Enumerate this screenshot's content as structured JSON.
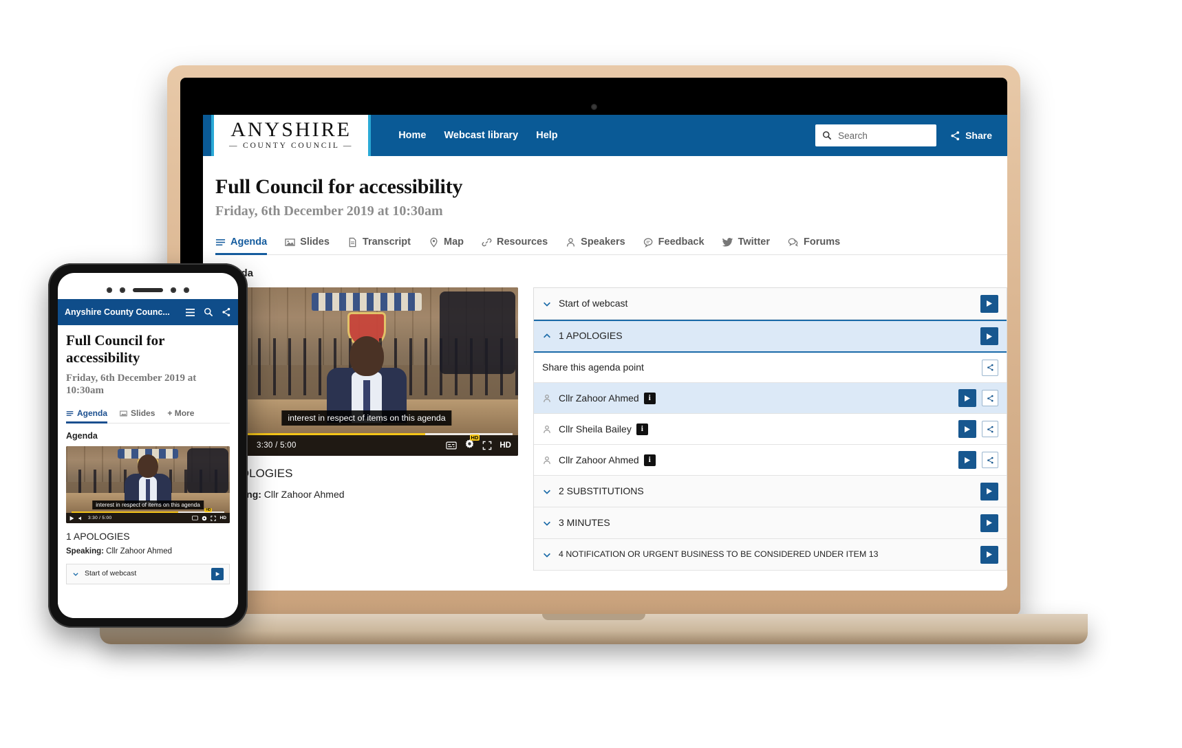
{
  "header": {
    "logo_main": "ANYSHIRE",
    "logo_sub": "— COUNTY COUNCIL —",
    "nav": [
      {
        "label": "Home"
      },
      {
        "label": "Webcast library"
      },
      {
        "label": "Help"
      }
    ],
    "search_placeholder": "Search",
    "search_value": "",
    "share_label": "Share",
    "bg_color": "#0a5a96",
    "accent_color": "#2aa9d6"
  },
  "page": {
    "title": "Full Council for accessibility",
    "subtitle": "Friday, 6th December 2019 at 10:30am",
    "section_label": "Agenda"
  },
  "tabs": [
    {
      "label": "Agenda",
      "icon": "list-icon",
      "active": true
    },
    {
      "label": "Slides",
      "icon": "image-icon",
      "active": false
    },
    {
      "label": "Transcript",
      "icon": "document-icon",
      "active": false
    },
    {
      "label": "Map",
      "icon": "pin-icon",
      "active": false
    },
    {
      "label": "Resources",
      "icon": "link-icon",
      "active": false
    },
    {
      "label": "Speakers",
      "icon": "person-icon",
      "active": false
    },
    {
      "label": "Feedback",
      "icon": "comment-icon",
      "active": false
    },
    {
      "label": "Twitter",
      "icon": "twitter-icon",
      "active": false
    },
    {
      "label": "Forums",
      "icon": "forums-icon",
      "active": false
    }
  ],
  "video": {
    "caption": "interest in respect of items on this agenda",
    "current_time": "3:30",
    "duration": "5:00",
    "time_display": "3:30 / 5:00",
    "progress_percent": 70,
    "quality_label": "HD",
    "quality_badge": "HD"
  },
  "now_playing": {
    "item_title": "1 APOLOGIES",
    "speaking_label": "Speaking:",
    "speaker_name": "Cllr Zahoor Ahmed"
  },
  "agenda": {
    "share_row_label": "Share this agenda point",
    "items": [
      {
        "label": "Start of webcast",
        "state": "collapsed",
        "selected": false
      },
      {
        "label": "1 APOLOGIES",
        "state": "expanded",
        "selected": true
      },
      {
        "label": "2 SUBSTITUTIONS",
        "state": "collapsed",
        "selected": false
      },
      {
        "label": "3 MINUTES",
        "state": "collapsed",
        "selected": false
      },
      {
        "label": "4 NOTIFICATION OR URGENT BUSINESS TO BE CONSIDERED UNDER ITEM 13",
        "state": "collapsed",
        "selected": false
      }
    ],
    "speakers": [
      {
        "name": "Cllr Zahoor Ahmed",
        "info_badge": "i",
        "highlighted": true
      },
      {
        "name": "Cllr Sheila Bailey",
        "info_badge": "i",
        "highlighted": false
      },
      {
        "name": "Cllr Zahoor Ahmed",
        "info_badge": "i",
        "highlighted": false
      }
    ]
  },
  "phone": {
    "brand": "Anyshire County Counc...",
    "title": "Full Council for accessibility",
    "subtitle": "Friday, 6th December 2019 at 10:30am",
    "section_label": "Agenda",
    "tabs": [
      {
        "label": "Agenda",
        "active": true
      },
      {
        "label": "Slides",
        "active": false
      },
      {
        "label": "+ More",
        "active": false
      }
    ],
    "item_title": "1 APOLOGIES",
    "speaking_label": "Speaking:",
    "speaker_name": "Cllr Zahoor Ahmed",
    "agenda_first_item": "Start of webcast",
    "video": {
      "caption": "interest in respect of items on this agenda",
      "time_display": "3:30 / 5:00",
      "quality_label": "HD"
    }
  }
}
